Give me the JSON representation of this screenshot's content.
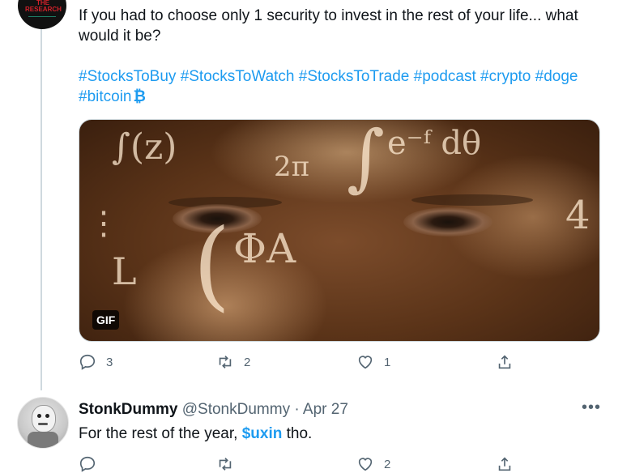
{
  "tweet": {
    "text": "If you had to choose only 1 security to invest in the rest of your life... what would it be?",
    "hashtags": [
      "#StocksToBuy",
      "#StocksToWatch",
      "#StocksToTrade",
      "#podcast",
      "#crypto",
      "#doge",
      "#bitcoin"
    ],
    "emoji": "₿",
    "media": {
      "badge": "GIF"
    },
    "actions": {
      "replies": "3",
      "retweets": "2",
      "likes": "1"
    },
    "avatar_text": "THE RESEARCH"
  },
  "reply": {
    "name": "StonkDummy",
    "handle": "@StonkDummy",
    "separator": "·",
    "date": "Apr 27",
    "text_before": "For the rest of the year,",
    "cashtag": "$uxin",
    "text_after": "tho.",
    "more": "•••",
    "actions": {
      "likes": "2"
    }
  },
  "colors": {
    "link": "#1d9bf0",
    "muted": "#536471",
    "text": "#0f1419",
    "bitcoin": "#f7931a"
  },
  "icons": [
    "reply-icon",
    "retweet-icon",
    "like-icon",
    "share-icon",
    "more-icon",
    "bitcoin-icon"
  ]
}
